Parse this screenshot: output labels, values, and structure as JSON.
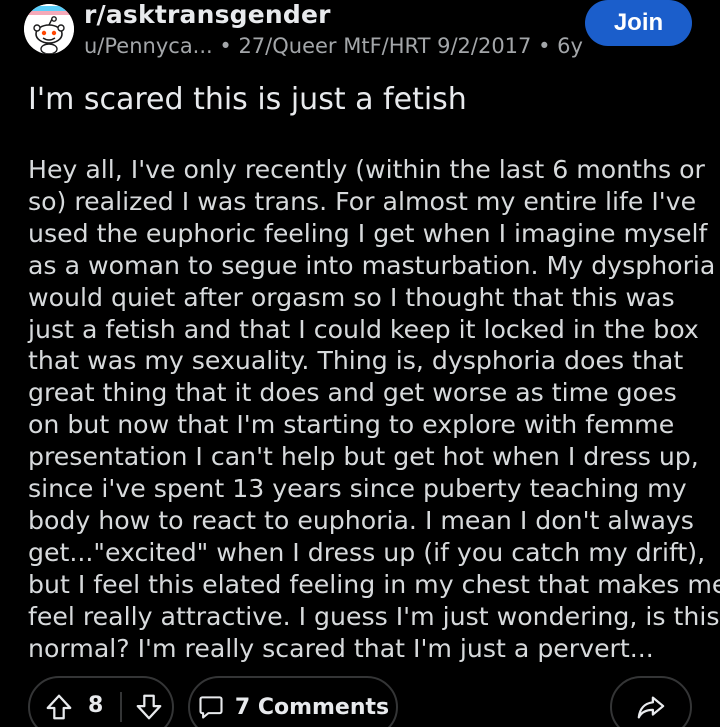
{
  "post": {
    "subreddit": "r/asktransgender",
    "meta": "u/Pennyca... • 27/Queer MtF/HRT 9/2/2017 • 6y",
    "join_label": "Join",
    "title": "I'm scared this is just a fetish",
    "body_lines": [
      "Hey all, I've only recently (within the last 6 months or",
      "so) realized I was trans. For almost my entire life I've",
      "used the euphoric feeling I get when I imagine myself",
      "as a woman to segue into masturbation. My dysphoria",
      "would quiet after orgasm so I thought that this was",
      "just a fetish and that I could keep it locked in the box",
      "that was my sexuality. Thing is, dysphoria does that",
      "great thing that it does and get worse as time goes",
      "on but now that I'm starting to explore with femme",
      "presentation I can't help but get hot when I dress up,",
      "since i've spent 13 years since puberty teaching my",
      "body how to react to euphoria. I mean I don't always",
      "get...\"excited\" when I dress up (if you catch my drift),",
      "but I feel this elated feeling in my chest that makes me",
      "feel really attractive. I guess I'm just wondering, is this",
      "normal? I'm really scared that I'm just a pervert..."
    ]
  },
  "actions": {
    "score": "8",
    "comments_label": "7 Comments"
  },
  "icons": {
    "avatar": "snoo-avatar-icon",
    "upvote": "upvote-arrow-icon",
    "downvote": "downvote-arrow-icon",
    "comments": "comment-bubble-icon",
    "share": "share-arrow-icon"
  },
  "colors": {
    "background": "#000000",
    "join_button": "#1b5ecb",
    "text": "#d7dadc",
    "muted_text": "#a3a6a9",
    "pill_border": "#343536"
  }
}
